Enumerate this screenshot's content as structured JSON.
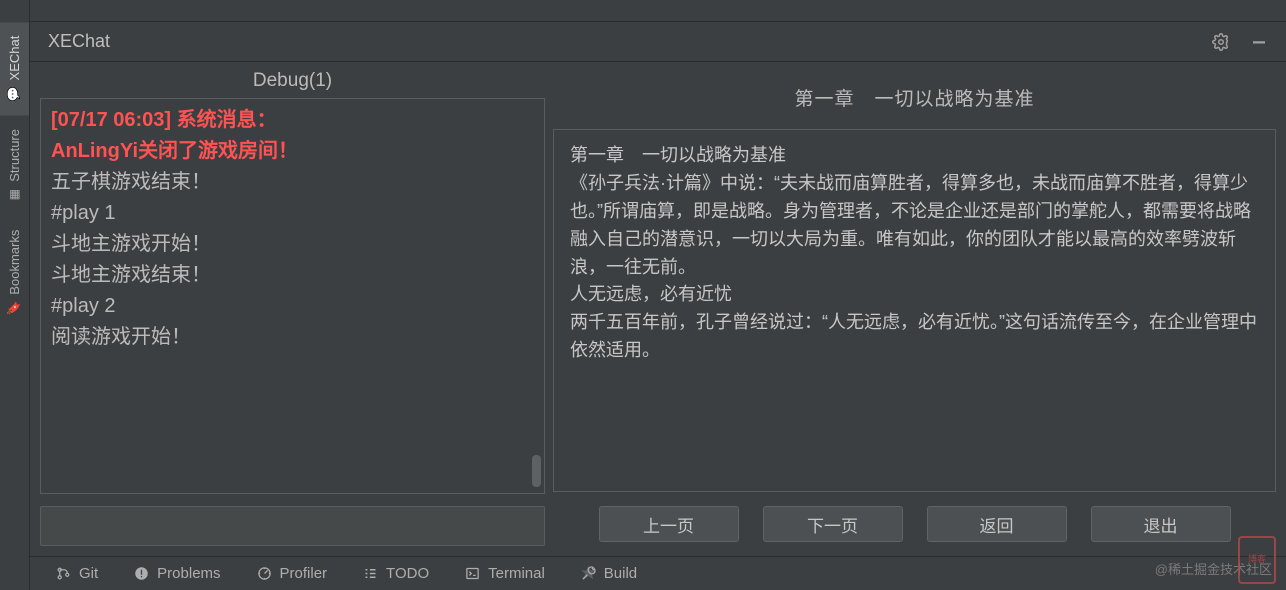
{
  "rail": {
    "items": [
      {
        "label": "XEChat",
        "icon": "chat"
      },
      {
        "label": "Structure",
        "icon": "structure"
      },
      {
        "label": "Bookmarks",
        "icon": "bookmark"
      }
    ]
  },
  "header": {
    "title": "XEChat"
  },
  "debug": {
    "title": "Debug(1)",
    "sys_msg_line1": "[07/17 06:03] 系统消息：",
    "sys_msg_line2": "AnLingYi关闭了游戏房间！",
    "lines": [
      "五子棋游戏结束！",
      "#play 1",
      "斗地主游戏开始！",
      "斗地主游戏结束！",
      "#play 2",
      "阅读游戏开始！"
    ]
  },
  "reader": {
    "title": "第一章　一切以战略为基准",
    "body": "第一章　一切以战略为基准\n《孙子兵法·计篇》中说：“夫未战而庙算胜者，得算多也，未战而庙算不胜者，得算少也。”所谓庙算，即是战略。身为管理者，不论是企业还是部门的掌舵人，都需要将战略融入自己的潜意识，一切以大局为重。唯有如此，你的团队才能以最高的效率劈波斩浪，一往无前。\n人无远虑，必有近忧\n两千五百年前，孔子曾经说过：“人无远虑，必有近忧。”这句话流传至今，在企业管理中依然适用。",
    "buttons": {
      "prev": "上一页",
      "next": "下一页",
      "back": "返回",
      "exit": "退出"
    }
  },
  "bottom": {
    "items": [
      {
        "label": "Git",
        "icon": "git"
      },
      {
        "label": "Problems",
        "icon": "problems"
      },
      {
        "label": "Profiler",
        "icon": "profiler"
      },
      {
        "label": "TODO",
        "icon": "todo"
      },
      {
        "label": "Terminal",
        "icon": "terminal"
      },
      {
        "label": "Build",
        "icon": "build"
      }
    ]
  },
  "watermark": "@稀土掘金技术社区"
}
